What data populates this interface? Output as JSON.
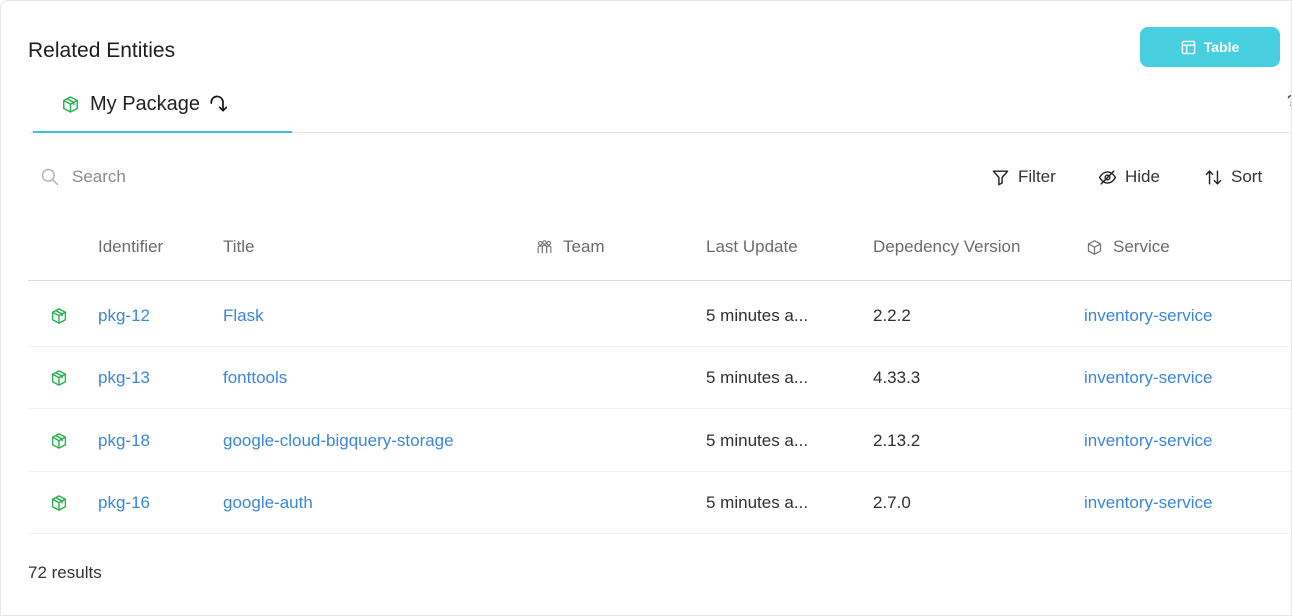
{
  "panel": {
    "title": "Related Entities",
    "view_button_label": "Table",
    "edge_glyph": "?"
  },
  "tabs": [
    {
      "label": "My Package",
      "icon": "package-icon",
      "active": true
    }
  ],
  "toolbar": {
    "search_placeholder": "Search",
    "filter_label": "Filter",
    "hide_label": "Hide",
    "sort_label": "Sort"
  },
  "table": {
    "columns": {
      "identifier": "Identifier",
      "title": "Title",
      "team": "Team",
      "last_update": "Last Update",
      "dependency_version": "Depedency Version",
      "service": "Service"
    },
    "rows": [
      {
        "identifier": "pkg-12",
        "title": "Flask",
        "team": "",
        "last_update": "5 minutes a...",
        "dependency_version": "2.2.2",
        "service": "inventory-service"
      },
      {
        "identifier": "pkg-13",
        "title": "fonttools",
        "team": "",
        "last_update": "5 minutes a...",
        "dependency_version": "4.33.3",
        "service": "inventory-service"
      },
      {
        "identifier": "pkg-18",
        "title": "google-cloud-bigquery-storage",
        "team": "",
        "last_update": "5 minutes a...",
        "dependency_version": "2.13.2",
        "service": "inventory-service"
      },
      {
        "identifier": "pkg-16",
        "title": "google-auth",
        "team": "",
        "last_update": "5 minutes a...",
        "dependency_version": "2.7.0",
        "service": "inventory-service"
      }
    ]
  },
  "footer": {
    "results": "72 results"
  },
  "colors": {
    "accent": "#47cfe0",
    "tab_underline": "#39c0db",
    "link": "#3b86d6",
    "package_icon": "#22b14c"
  }
}
